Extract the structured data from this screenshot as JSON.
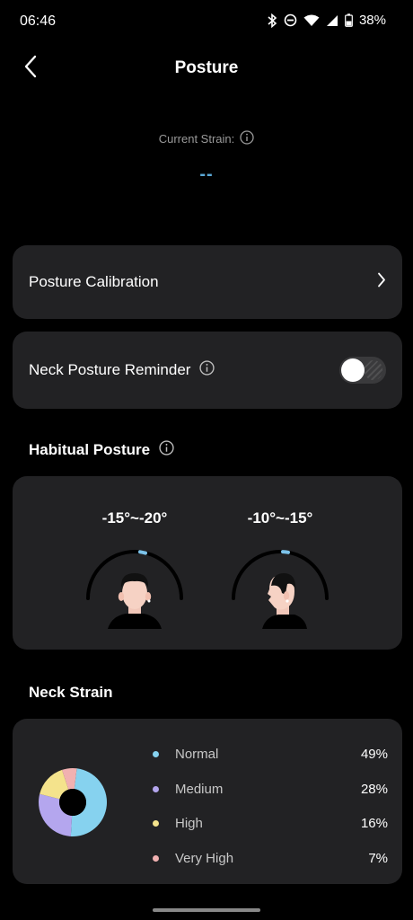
{
  "status_bar": {
    "time": "06:46",
    "battery": "38%"
  },
  "header": {
    "title": "Posture"
  },
  "current_strain": {
    "label": "Current Strain:",
    "value": "--",
    "value_color": "#5aa8d6"
  },
  "settings": {
    "calibration_label": "Posture Calibration",
    "reminder_label": "Neck Posture Reminder",
    "reminder_enabled": false
  },
  "habitual_posture": {
    "heading": "Habitual Posture",
    "front_range": "-15°~-20°",
    "side_range": "-10°~-15°"
  },
  "neck_strain": {
    "heading": "Neck Strain",
    "items": [
      {
        "label": "Normal",
        "value": "49%",
        "percent": 49,
        "color": "#86d2ef"
      },
      {
        "label": "Medium",
        "value": "28%",
        "percent": 28,
        "color": "#b4a6ee"
      },
      {
        "label": "High",
        "value": "16%",
        "percent": 16,
        "color": "#f4e38c"
      },
      {
        "label": "Very High",
        "value": "7%",
        "percent": 7,
        "color": "#f1b1b1"
      }
    ]
  },
  "icons": {
    "back": "chevron-left-icon",
    "info": "info-icon",
    "chevron": "chevron-right-icon",
    "bluetooth": "bluetooth-icon",
    "dnd": "do-not-disturb-icon",
    "wifi": "wifi-icon",
    "signal": "cell-signal-icon",
    "battery": "battery-icon"
  }
}
